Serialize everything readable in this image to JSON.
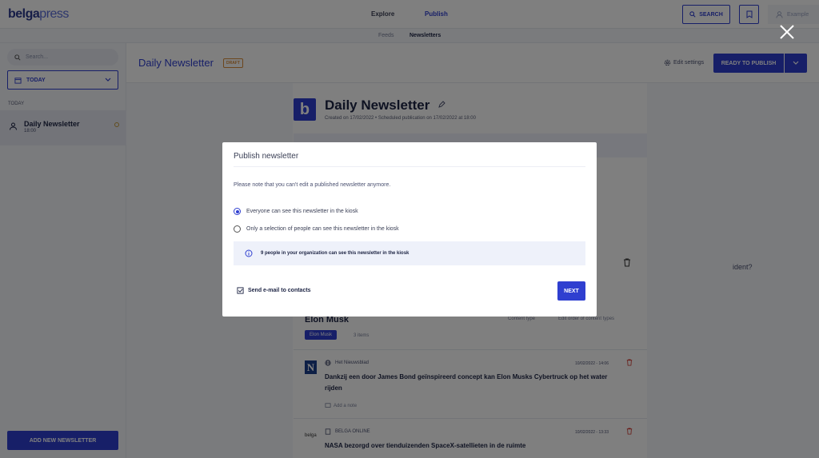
{
  "app": {
    "logo_main": "belga",
    "logo_sub": "press"
  },
  "topnav": {
    "explore": "Explore",
    "publish": "Publish",
    "search_label": "SEARCH",
    "user_label": "Example"
  },
  "subnav": {
    "feeds": "Feeds",
    "newsletters": "Newsletters"
  },
  "sidebar": {
    "search_placeholder": "Search...",
    "date_filter": "TODAY",
    "section_label": "TODAY",
    "items": [
      {
        "name": "Daily Newsletter",
        "time": "18:00"
      }
    ],
    "add_button": "ADD NEW NEWSLETTER"
  },
  "header": {
    "title": "Daily Newsletter",
    "badge": "DRAFT",
    "edit_settings": "Edit settings",
    "ready_button": "READY TO PUBLISH"
  },
  "newsletter": {
    "logo_letter": "b",
    "title": "Daily Newsletter",
    "meta": "Created on 17/02/2022  •  Scheduled publication on 17/02/2022 at 18:00",
    "snippet_right": "ident?",
    "section_title": "Elon Musk",
    "content_type": "Content type",
    "edit_order": "Edit order of content types",
    "chip": "Elon Musk",
    "items_count": "3 items",
    "articles": [
      {
        "logo": "N",
        "source": "Het Nieuwsblad",
        "date": "10/02/2022 - 14:06",
        "title": "Dankzij een door James Bond geïnspireerd concept kan Elon Musks Cybertruck op het water rijden",
        "note": "Add a note"
      },
      {
        "logo": "belga",
        "source": "BELGA ONLINE",
        "date": "10/02/2022 - 13:33",
        "title": "NASA bezorgd over tienduizenden SpaceX-satellieten in de ruimte"
      }
    ]
  },
  "modal": {
    "title": "Publish newsletter",
    "note": "Please note that you can't edit a published newsletter anymore.",
    "option_everyone": "Everyone can see this newsletter in the kiosk",
    "option_selection": "Only a selection of people can see this newsletter in the kiosk",
    "selected_option": "everyone",
    "info": "9 people in your organization can see this newsletter in the kiosk",
    "send_email": "Send e-mail to contacts",
    "next_button": "NEXT"
  },
  "colors": {
    "accent": "#2f3fd0",
    "draft": "#d98c3a",
    "delete": "#d0342c"
  }
}
